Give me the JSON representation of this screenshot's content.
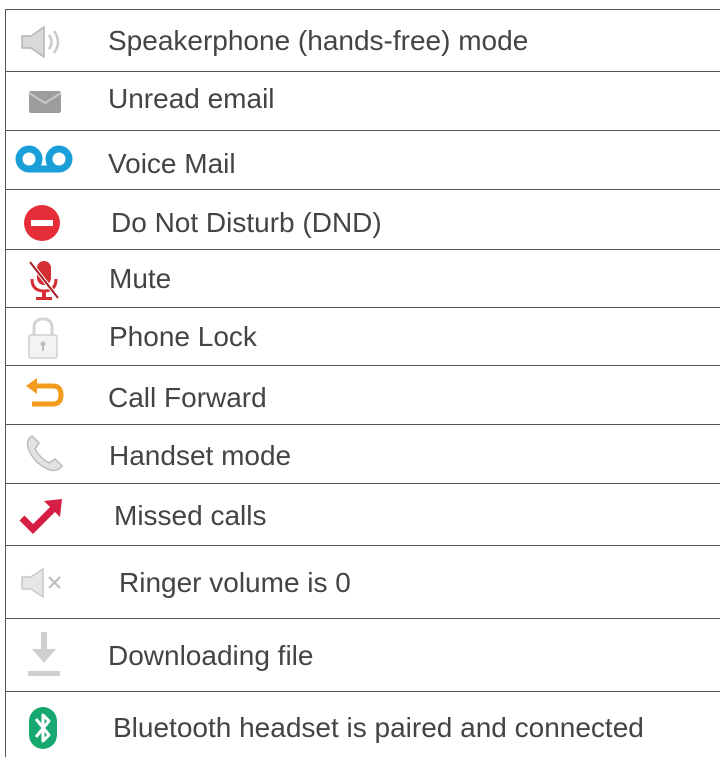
{
  "rows": [
    {
      "icon": "speaker-icon",
      "label": "Speakerphone (hands-free) mode"
    },
    {
      "icon": "envelope-icon",
      "label": "Unread email"
    },
    {
      "icon": "voicemail-icon",
      "label": "Voice Mail"
    },
    {
      "icon": "dnd-icon",
      "label": "Do Not Disturb (DND)"
    },
    {
      "icon": "muted-microphone-icon",
      "label": "Mute"
    },
    {
      "icon": "padlock-icon",
      "label": "Phone Lock"
    },
    {
      "icon": "forward-arrow-icon",
      "label": "Call Forward"
    },
    {
      "icon": "handset-icon",
      "label": "Handset mode"
    },
    {
      "icon": "missed-call-arrow-icon",
      "label": "Missed calls"
    },
    {
      "icon": "speaker-muted-icon",
      "label": "Ringer volume is 0"
    },
    {
      "icon": "download-icon",
      "label": "Downloading file"
    },
    {
      "icon": "bluetooth-icon",
      "label": "Bluetooth headset is paired and connected"
    }
  ],
  "colors": {
    "border": "#555555",
    "text": "#444444",
    "voicemail": "#1a9fd9",
    "dnd": "#e52e37",
    "mute": "#d42d34",
    "forward": "#f29b1d",
    "missed": "#d61f45",
    "bluetooth": "#17a86f",
    "gray_icon": "#bdbdbd"
  }
}
